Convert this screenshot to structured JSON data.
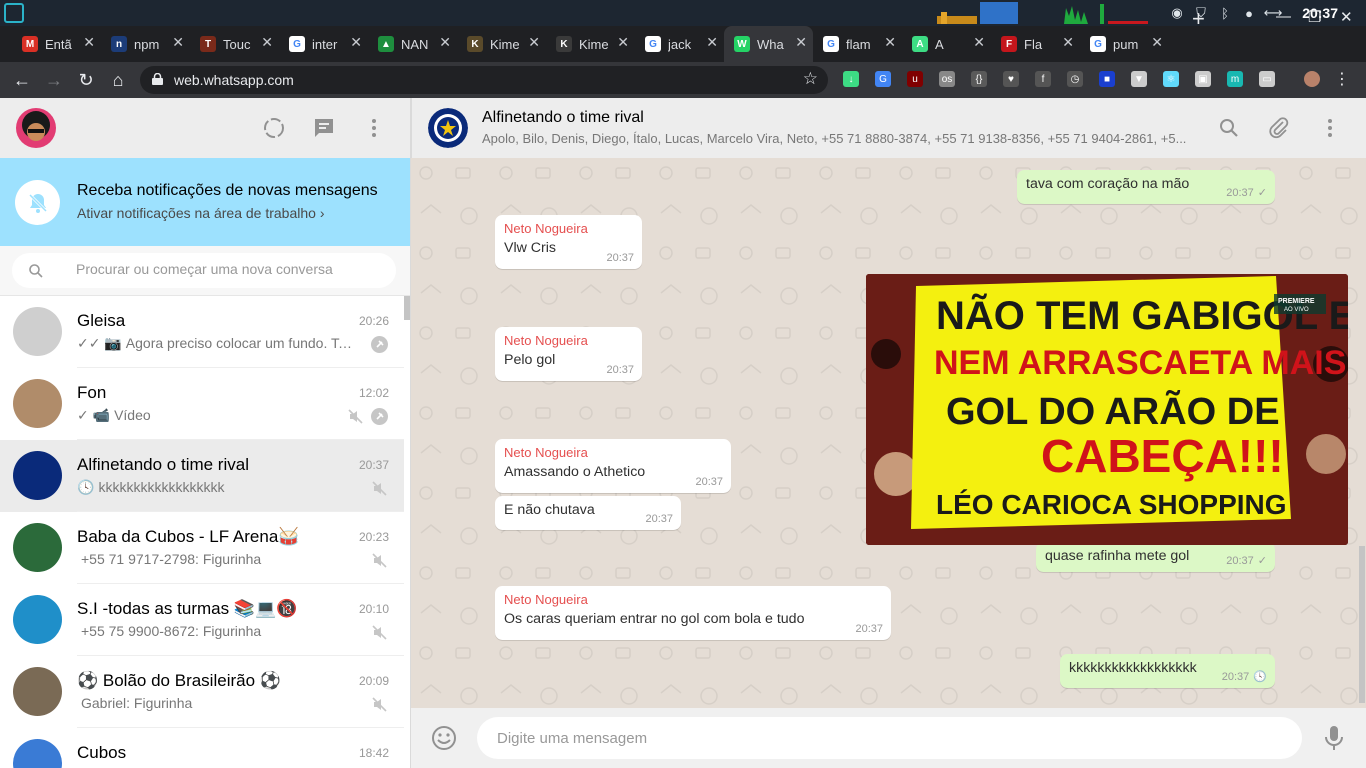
{
  "os_bar": {
    "clock": "20:37",
    "tray_icons": [
      "steam-icon",
      "shield-icon",
      "bluetooth-icon",
      "user-icon",
      "network-icon"
    ]
  },
  "browser": {
    "tabs": [
      {
        "label": "Entã",
        "favicon": "gmail-icon",
        "color": "#d93025",
        "letter": "M"
      },
      {
        "label": "npm",
        "favicon": "npm-icon",
        "color": "#1c3c78",
        "letter": "n"
      },
      {
        "label": "Touc",
        "favicon": "touch-icon",
        "color": "#7a2a1a",
        "letter": "T"
      },
      {
        "label": "inter",
        "favicon": "google-icon",
        "color": "#ffffff",
        "letter": "G"
      },
      {
        "label": "NAN",
        "favicon": "drive-icon",
        "color": "#1e8e3e",
        "letter": "▲"
      },
      {
        "label": "Kime",
        "favicon": "kime-icon",
        "color": "#5a4a2a",
        "letter": "K"
      },
      {
        "label": "Kime",
        "favicon": "kime-icon",
        "color": "#3a3a3a",
        "letter": "K"
      },
      {
        "label": "jack",
        "favicon": "google-icon",
        "color": "#ffffff",
        "letter": "G"
      },
      {
        "label": "Wha",
        "favicon": "whatsapp-icon",
        "color": "#25d366",
        "letter": "W",
        "active": true
      },
      {
        "label": "flam",
        "favicon": "google-icon",
        "color": "#ffffff",
        "letter": "G"
      },
      {
        "label": "A",
        "favicon": "android-icon",
        "color": "#3ddc84",
        "letter": "A"
      },
      {
        "label": "Fla",
        "favicon": "flamengo-icon",
        "color": "#c4161c",
        "letter": "F"
      },
      {
        "label": "pum",
        "favicon": "google-icon",
        "color": "#ffffff",
        "letter": "G"
      }
    ],
    "url": "web.whatsapp.com"
  },
  "sidebar": {
    "notification": {
      "title": "Receba notificações de novas mensagens",
      "link": "Ativar notificações na área de trabalho"
    },
    "search_placeholder": "Procurar ou começar uma nova conversa",
    "chats": [
      {
        "name": "Gleisa",
        "time": "20:26",
        "preview": "Agora preciso colocar um fundo. Talv...",
        "prefix": "✓✓ 📷",
        "muted": false,
        "pinned": true,
        "avatar": "#cfcfcf"
      },
      {
        "name": "Fon",
        "time": "12:02",
        "preview": "Vídeo",
        "prefix": "✓ 📹",
        "muted": true,
        "pinned": true,
        "avatar": "#b08c6a"
      },
      {
        "name": "Alfinetando o time rival",
        "time": "20:37",
        "preview": "kkkkkkkkkkkkkkkkkk",
        "prefix": "🕓",
        "muted": true,
        "pinned": false,
        "avatar": "#0a2a7a",
        "selected": true
      },
      {
        "name": "Baba da Cubos - LF Arena🥁",
        "time": "20:23",
        "preview": "+55 71 9717-2798: Figurinha",
        "prefix": "",
        "muted": true,
        "pinned": false,
        "avatar": "#2b6a3a"
      },
      {
        "name": "S.I -todas as turmas 📚💻🔞",
        "time": "20:10",
        "preview": "+55 75 9900-8672: Figurinha",
        "prefix": "",
        "muted": true,
        "pinned": false,
        "avatar": "#1f8fc9"
      },
      {
        "name": "⚽ Bolão do Brasileirão ⚽",
        "time": "20:09",
        "preview": "Gabriel: Figurinha",
        "prefix": "",
        "muted": true,
        "pinned": false,
        "avatar": "#7a6a55"
      },
      {
        "name": "Cubos",
        "time": "18:42",
        "preview": "",
        "prefix": "",
        "muted": false,
        "pinned": false,
        "avatar": "#3a7bd5"
      }
    ]
  },
  "conversation": {
    "title": "Alfinetando o time rival",
    "members": "Apolo, Bilo, Denis, Diego, Ítalo, Lucas, Marcelo Vira, Neto, +55 71 8880-3874, +55 71 9138-8356, +55 71 9404-2861, +5...",
    "messages": [
      {
        "dir": "out",
        "text": "tava com coração na mão",
        "time": "20:37",
        "status": "✓"
      },
      {
        "dir": "in",
        "sender": "Neto Nogueira",
        "text": "Vlw Cris",
        "time": "20:37"
      },
      {
        "dir": "in",
        "sender": "Neto Nogueira",
        "text": "Pelo gol",
        "time": "20:37"
      },
      {
        "dir": "in",
        "sender": "Neto Nogueira",
        "text": "Amassando o Athetico",
        "time": "20:37"
      },
      {
        "dir": "in",
        "text": "E não chutava",
        "time": "20:37"
      },
      {
        "dir": "out",
        "text": "quase rafinha mete gol",
        "time": "20:37",
        "status": "✓"
      },
      {
        "dir": "in",
        "sender": "Neto Nogueira",
        "text": "Os caras queriam entrar no gol com bola e tudo",
        "time": "20:37"
      },
      {
        "dir": "out",
        "text": "kkkkkkkkkkkkkkkkkk",
        "time": "20:37",
        "status": "🕓"
      }
    ],
    "image": {
      "sign_lines": [
        "NÃO TEM GABIGOL E",
        "NEM ARRASCAETA MAIS TEM",
        "GOL DO ARÃO DE",
        "CABEÇA!!!",
        "LÉO CARIOCA SHOPPING"
      ],
      "badge": "PREMIERE",
      "badge_sub": "AO VIVO"
    },
    "composer_placeholder": "Digite uma mensagem"
  },
  "colors": {
    "whatsapp_green": "#25d366",
    "bubble_out": "#dcf8c6",
    "bubble_in": "#ffffff",
    "notification_bg": "#9de1fe",
    "chat_bg": "#e5ddd5",
    "sender_name": "#e54f4f"
  }
}
